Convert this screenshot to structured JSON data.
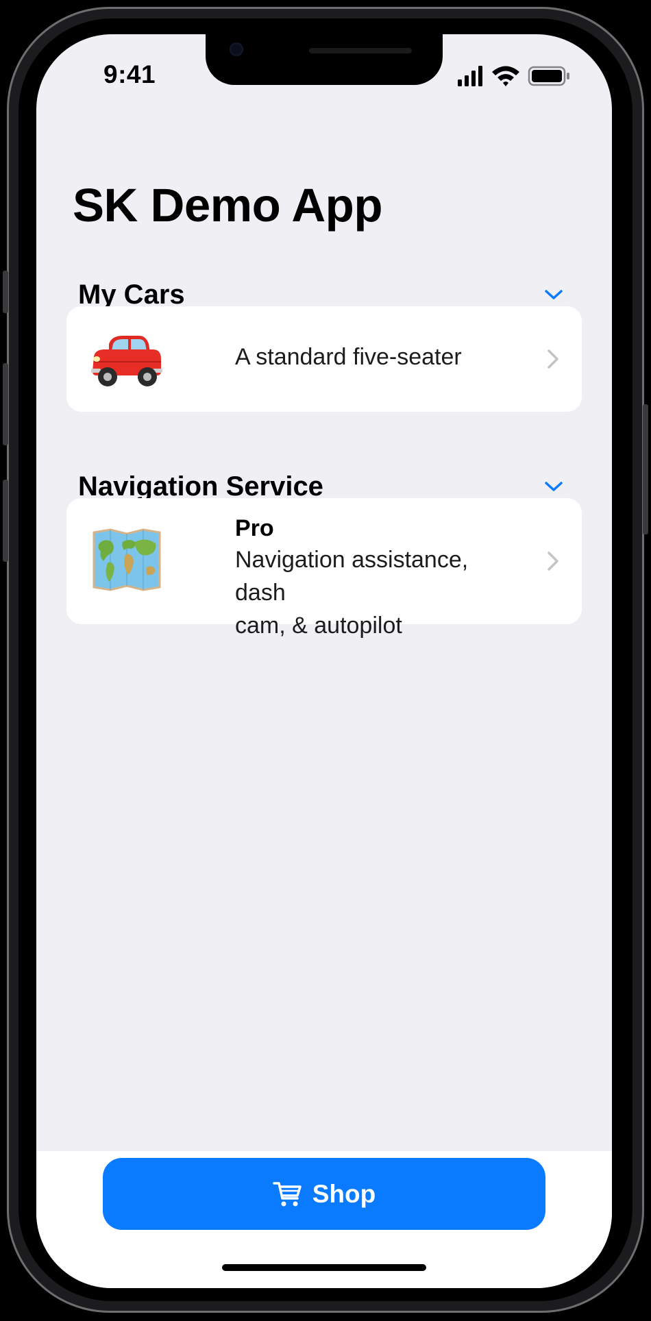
{
  "status_bar": {
    "time": "9:41",
    "icons": [
      "cellular-signal-icon",
      "wifi-icon",
      "battery-icon"
    ]
  },
  "app": {
    "title": "SK Demo App"
  },
  "sections": [
    {
      "title": "My Cars",
      "rows": [
        {
          "icon": "red-car-icon",
          "text": "A standard five-seater"
        }
      ]
    },
    {
      "title": "Navigation Service",
      "rows": [
        {
          "icon": "world-map-icon",
          "title": "Pro",
          "text_line_1": "Navigation assistance, dash",
          "text_line_2": "cam, & autopilot"
        }
      ]
    }
  ],
  "shop_button": {
    "label": "Shop",
    "icon": "cart-icon"
  },
  "colors": {
    "accent": "#0a7aff",
    "background": "#efeff4",
    "card": "#ffffff"
  }
}
